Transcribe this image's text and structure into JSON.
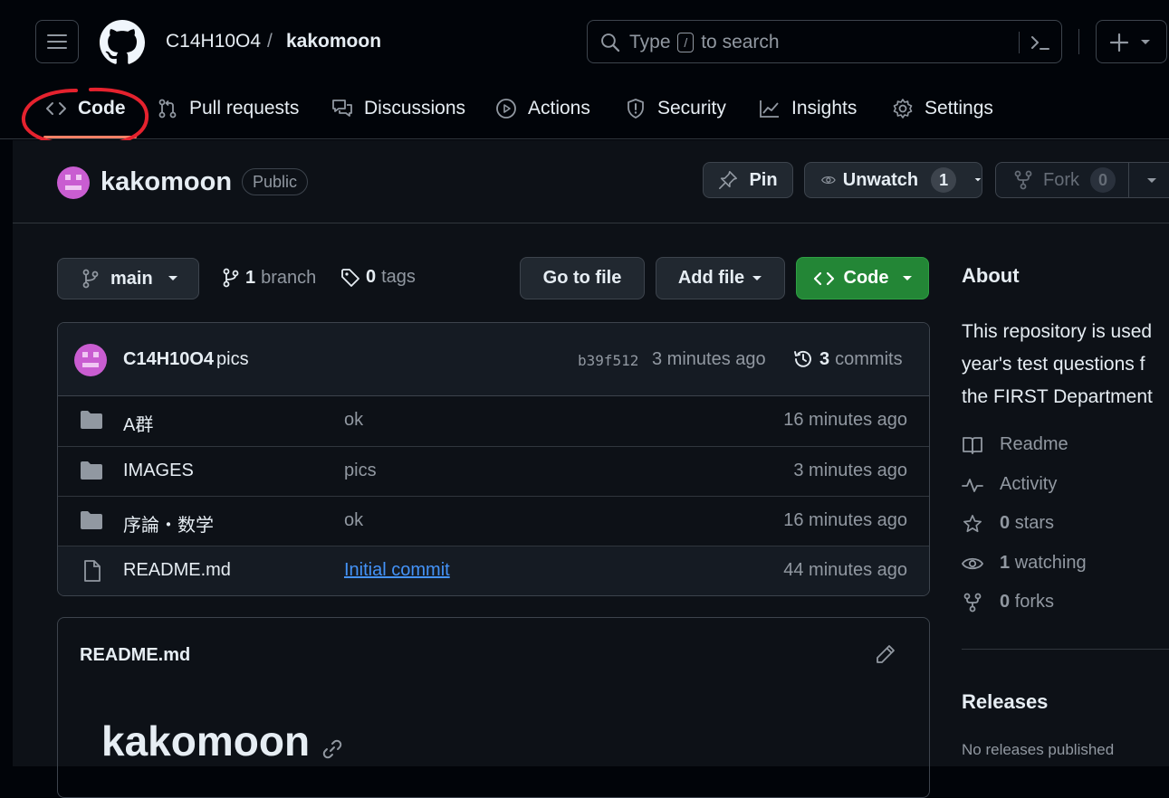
{
  "header": {
    "owner": "C14H10O4",
    "separator": "/",
    "repo": "kakomoon",
    "search": {
      "before": "Type",
      "key": "/",
      "after": "to search"
    },
    "plus_label": "+"
  },
  "tabs": [
    {
      "label": "Code",
      "icon": "code-icon"
    },
    {
      "label": "Pull requests",
      "icon": "git-pull-request-icon"
    },
    {
      "label": "Discussions",
      "icon": "comment-discussion-icon"
    },
    {
      "label": "Actions",
      "icon": "play-icon"
    },
    {
      "label": "Security",
      "icon": "shield-icon"
    },
    {
      "label": "Insights",
      "icon": "graph-icon"
    },
    {
      "label": "Settings",
      "icon": "gear-icon"
    }
  ],
  "annotation": {
    "color": "#e5222e",
    "target": "tab-code"
  },
  "repo": {
    "name": "kakomoon",
    "visibility": "Public",
    "pin_label": "Pin",
    "watch_label": "Unwatch",
    "watch_count": "1",
    "fork_label": "Fork",
    "fork_count": "0"
  },
  "toolbar": {
    "branch": "main",
    "branches_count": "1",
    "branches_label": "branch",
    "tags_count": "0",
    "tags_label": "tags",
    "goto_file": "Go to file",
    "add_file": "Add file",
    "code_button": "Code"
  },
  "latest_commit": {
    "author": "C14H10O4",
    "message": "pics",
    "sha": "b39f512",
    "age": "3 minutes ago",
    "commits_count": "3",
    "commits_label": "commits"
  },
  "files": [
    {
      "type": "folder",
      "name": "A群",
      "message": "ok",
      "age": "16 minutes ago"
    },
    {
      "type": "folder",
      "name": "IMAGES",
      "message": "pics",
      "age": "3 minutes ago"
    },
    {
      "type": "folder",
      "name": "序論・数学",
      "message": "ok",
      "age": "16 minutes ago"
    },
    {
      "type": "file",
      "name": "README.md",
      "message": "Initial commit",
      "age": "44 minutes ago"
    }
  ],
  "readme": {
    "filename": "README.md",
    "heading": "kakomoon"
  },
  "about": {
    "title": "About",
    "description_lines": [
      "This repository is used",
      "year's test questions f",
      "the FIRST Department"
    ],
    "items": [
      {
        "icon": "book-icon",
        "label": "Readme"
      },
      {
        "icon": "pulse-icon",
        "label": "Activity"
      },
      {
        "icon": "star-icon",
        "count": "0",
        "label": "stars"
      },
      {
        "icon": "eye-icon",
        "count": "1",
        "label": "watching"
      },
      {
        "icon": "repo-forked-icon",
        "count": "0",
        "label": "forks"
      }
    ],
    "releases_title": "Releases",
    "releases_text": "No releases published"
  },
  "colors": {
    "background": "#0d1117",
    "header_bg": "#010409",
    "accent_green": "#238636",
    "link_blue": "#4493f8",
    "avatar": "#c95dd1"
  }
}
